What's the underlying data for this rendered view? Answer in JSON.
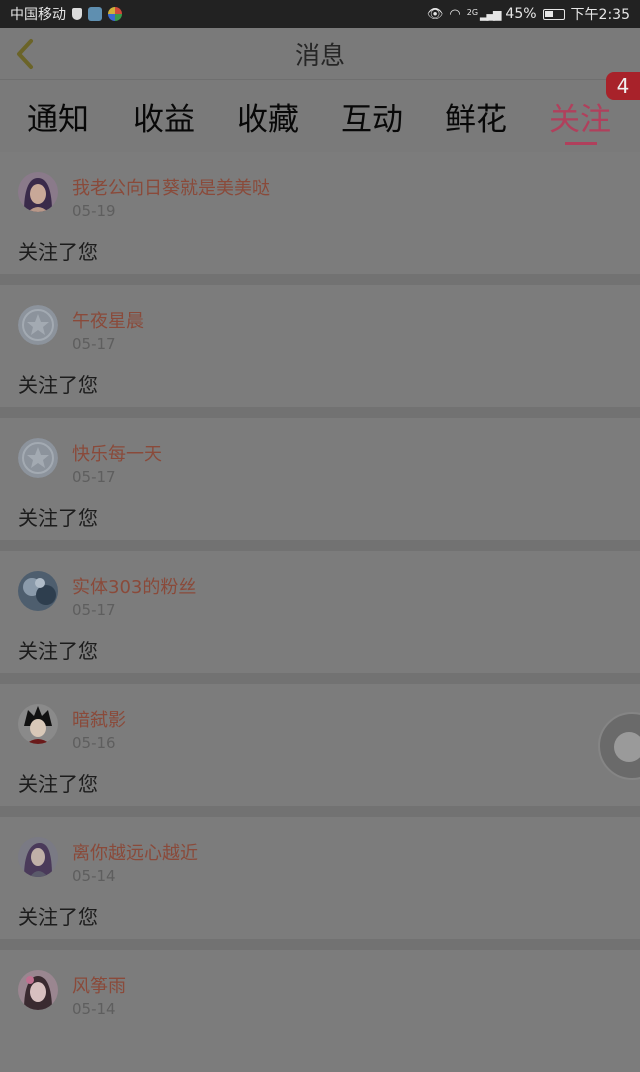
{
  "status_bar": {
    "carrier": "中国移动",
    "network": "2G",
    "battery": "45%",
    "time": "下午2:35"
  },
  "header": {
    "title": "消息"
  },
  "tabs": {
    "items": [
      {
        "label": "通知"
      },
      {
        "label": "收益"
      },
      {
        "label": "收藏"
      },
      {
        "label": "互动"
      },
      {
        "label": "鲜花"
      },
      {
        "label": "关注"
      }
    ],
    "active_index": 5,
    "badge": "4"
  },
  "messages": [
    {
      "name": "我老公向日葵就是美美哒",
      "date": "05-19",
      "text": "关注了您",
      "avatar": "avatar-girl-purple-hair"
    },
    {
      "name": "午夜星晨",
      "date": "05-17",
      "text": "关注了您",
      "avatar": "default-star-avatar"
    },
    {
      "name": "快乐每一天",
      "date": "05-17",
      "text": "关注了您",
      "avatar": "default-star-avatar"
    },
    {
      "name": "实体303的粉丝",
      "date": "05-17",
      "text": "关注了您",
      "avatar": "avatar-blue-scene"
    },
    {
      "name": "暗弑影",
      "date": "05-16",
      "text": "关注了您",
      "avatar": "avatar-anime-dark-hair"
    },
    {
      "name": "离你越远心越近",
      "date": "05-14",
      "text": "关注了您",
      "avatar": "avatar-anime-purple"
    },
    {
      "name": "风筝雨",
      "date": "05-14",
      "text": "",
      "avatar": "avatar-girl-pink"
    }
  ],
  "colors": {
    "accent": "#b0405c",
    "badge": "#a8222a",
    "name_text": "#8a4a3a"
  }
}
